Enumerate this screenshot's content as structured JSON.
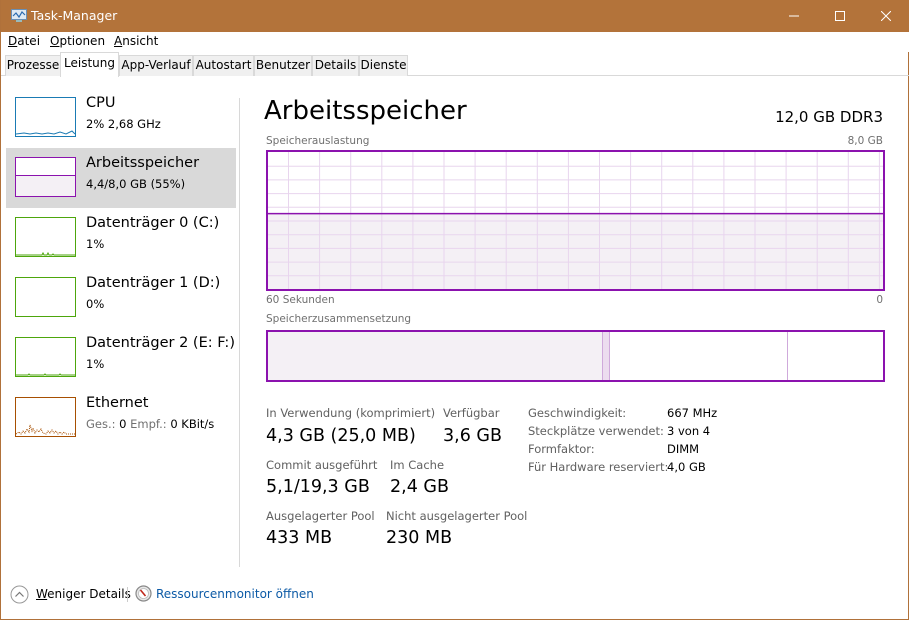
{
  "window": {
    "title": "Task-Manager",
    "controls": {
      "minimize": "minimize",
      "maximize": "maximize",
      "close": "close"
    }
  },
  "menu": [
    {
      "label": "Datei",
      "accel": "D",
      "rest": "atei"
    },
    {
      "label": "Optionen",
      "accel": "O",
      "rest": "ptionen"
    },
    {
      "label": "Ansicht",
      "accel": "A",
      "rest": "nsicht"
    }
  ],
  "tabs": [
    {
      "label": "Prozesse",
      "active": false
    },
    {
      "label": "Leistung",
      "active": true
    },
    {
      "label": "App-Verlauf",
      "active": false
    },
    {
      "label": "Autostart",
      "active": false
    },
    {
      "label": "Benutzer",
      "active": false
    },
    {
      "label": "Details",
      "active": false
    },
    {
      "label": "Dienste",
      "active": false
    }
  ],
  "sidebar": {
    "items": [
      {
        "title": "CPU",
        "sub": "2% 2,68 GHz",
        "color": "#1a7bb4",
        "selected": false
      },
      {
        "title": "Arbeitsspeicher",
        "sub": "4,4/8,0 GB (55%)",
        "color": "#8b12ae",
        "selected": true,
        "usage_fraction": 0.55
      },
      {
        "title": "Datenträger 0 (C:)",
        "sub": "1%",
        "color": "#4da60c",
        "selected": false
      },
      {
        "title": "Datenträger 1 (D:)",
        "sub": "0%",
        "color": "#4da60c",
        "selected": false
      },
      {
        "title": "Datenträger 2 (E: F:)",
        "sub": "1%",
        "color": "#4da60c",
        "selected": false
      },
      {
        "title": "Ethernet",
        "sub_parts": [
          "Ges.:",
          "0",
          "Empf.:",
          "0 KBit/s"
        ],
        "color": "#a74f01",
        "selected": false
      }
    ]
  },
  "main": {
    "title": "Arbeitsspeicher",
    "spec": "12,0 GB DDR3",
    "usage_graph": {
      "label": "Speicherauslastung",
      "max_label": "8,0 GB",
      "x_left_label": "60 Sekunden",
      "x_right_label": "0",
      "usage_fraction": 0.55,
      "line_color": "#8b12ae",
      "fill_color": "#f4f0f5",
      "grid_color": "#e8d5ee"
    },
    "composition": {
      "label": "Speicherzusammensetzung",
      "segments": [
        {
          "name": "in-use",
          "fraction": 0.545,
          "color": "#f4f0f5"
        },
        {
          "name": "modified",
          "fraction": 0.011,
          "color": "#ecdcef"
        },
        {
          "name": "standby",
          "fraction": 0.289,
          "color": "#ffffff"
        },
        {
          "name": "free",
          "fraction": 0.155,
          "color": "#ffffff"
        }
      ]
    },
    "stats": {
      "in_use_label": "In Verwendung (komprimiert)",
      "in_use_value": "4,3 GB (25,0 MB)",
      "available_label": "Verfügbar",
      "available_value": "3,6 GB",
      "commit_label": "Commit ausgeführt",
      "commit_value": "5,1/19,3 GB",
      "cache_label": "Im Cache",
      "cache_value": "2,4 GB",
      "paged_label": "Ausgelagerter Pool",
      "paged_value": "433 MB",
      "nonpaged_label": "Nicht ausgelagerter Pool",
      "nonpaged_value": "230 MB"
    },
    "details": [
      {
        "label": "Geschwindigkeit:",
        "value": "667 MHz"
      },
      {
        "label": "Steckplätze verwendet:",
        "value": "3 von 4"
      },
      {
        "label": "Formfaktor:",
        "value": "DIMM"
      },
      {
        "label": "Für Hardware reserviert:",
        "value": "4,0 GB"
      }
    ]
  },
  "footer": {
    "less_details_accel": "W",
    "less_details_rest": "eniger Details",
    "resource_monitor": "Ressourcenmonitor öffnen"
  }
}
